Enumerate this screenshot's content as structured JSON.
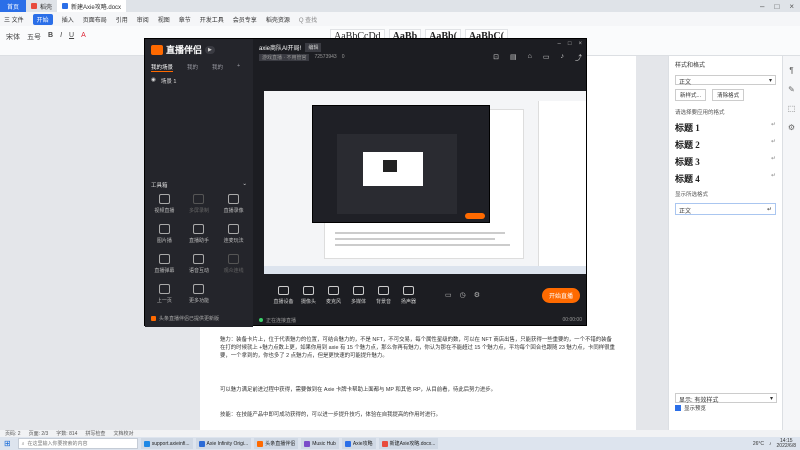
{
  "wps": {
    "tabs": [
      {
        "label": "首页",
        "type": "home"
      },
      {
        "label": "稻壳",
        "color": "#e84b3c"
      },
      {
        "label": "新建Axie攻略.docx",
        "color": "#2b6fe8",
        "active": true
      }
    ],
    "menu": [
      "三 文件",
      "开始",
      "插入",
      "页面布局",
      "引用",
      "审阅",
      "视图",
      "章节",
      "开发工具",
      "会员专享",
      "稻壳资源"
    ],
    "menu_active": "开始",
    "search_label": "Q 查找",
    "ribbon_tools": [
      "宋体",
      "五号",
      "B",
      "I",
      "U",
      "A"
    ],
    "style_samples": [
      "AaBbCcDd",
      "AaBb",
      "AaBb(",
      "AaBbC("
    ],
    "doc_paragraphs": [
      "魅力：装备卡片上，位于代表魅力的位置，可结合魅力的，不是 NFT，不可交易，每个属性星级的数，可以在 NFT 商店出售，只能获得一些重要的，一个不错的装备在打的时候就上 +魅力点数上更，如果你用到 axie 有 15 个魅力点，那么你再有魅力，你认为那在不能超过 15 个魅力点，平均每个回合也跟随 23 魅力点，卡同样很重要，一个拿到的，你也多了 2 点魅力点，但是更快速的可能提升魅力。",
      "可以魅力满足前进过程中获得，需要做到在 Axie 卡牌卡帮助上面都与 MP 和其他 RP，从目前看，待此后努力进步。",
      "技能：在技能产品中即可成功获得的，可以进一步提升技巧，体验在自我提高的作用时进行。"
    ],
    "status_bar": [
      "页码: 2",
      "页面: 2/3",
      "字数: 814",
      "拼写检查",
      "文档校对"
    ]
  },
  "style_panel": {
    "title": "样式和格式",
    "current": "正文",
    "new_style": "新样式...",
    "clear": "清除格式",
    "subtitle": "请选择要应用的格式",
    "headings": [
      "标题 1",
      "标题 2",
      "标题 3",
      "标题 4"
    ],
    "show_toggle": "显示所选格式",
    "selected": "正文",
    "show_label": "显示: 有效样式",
    "checkbox": "显示预览"
  },
  "recorder": {
    "app_name": "直播伴侣",
    "play_badge": "▶",
    "left_tabs": [
      "我的场景",
      "我的",
      "我的"
    ],
    "scene_name": "场景 1",
    "tools_title": "工具箱",
    "tools": [
      {
        "label": "视频直播",
        "dim": false
      },
      {
        "label": "多屏录制",
        "dim": true
      },
      {
        "label": "直播录像",
        "dim": false
      },
      {
        "label": "图片播",
        "dim": false
      },
      {
        "label": "直播助手",
        "dim": false
      },
      {
        "label": "连麦玩法",
        "dim": false
      },
      {
        "label": "直播弹幕",
        "dim": false
      },
      {
        "label": "语音互动",
        "dim": false
      },
      {
        "label": "观众连线",
        "dim": true
      },
      {
        "label": "上一页",
        "dim": false
      },
      {
        "label": "更多功能",
        "dim": false
      }
    ],
    "bottom_notice": "头条直播伴侣已提供更新版",
    "title": "axie商队AI开局!",
    "edit_label": "编辑",
    "sub_tag": "游戏直播 · 不用管官",
    "sub_id": "72573943",
    "sub_fans": "0",
    "bar_buttons": [
      "直播设备",
      "摄像头",
      "麦克风",
      "多媒体",
      "背景音",
      "扬声器"
    ],
    "start_label": "开始直播",
    "status_left": "正在连接直播",
    "status_right": "00:00:00"
  },
  "taskbar": {
    "search_placeholder": "在这里输入你要搜索的内容",
    "apps": [
      {
        "label": "support.axieinfi...",
        "color": "#1e88e5"
      },
      {
        "label": "Axie Infinity Origi...",
        "color": "#2c6bd6"
      },
      {
        "label": "头条直播伴侣",
        "color": "#ff6a00"
      },
      {
        "label": "Music Hub",
        "color": "#7b4cc9"
      },
      {
        "label": "Axie攻略",
        "color": "#2b6fe8"
      },
      {
        "label": "新建Axie攻略.docx...",
        "color": "#e84b3c"
      }
    ],
    "weather": "26°C",
    "time": "14:15",
    "date": "2022/6/8"
  }
}
